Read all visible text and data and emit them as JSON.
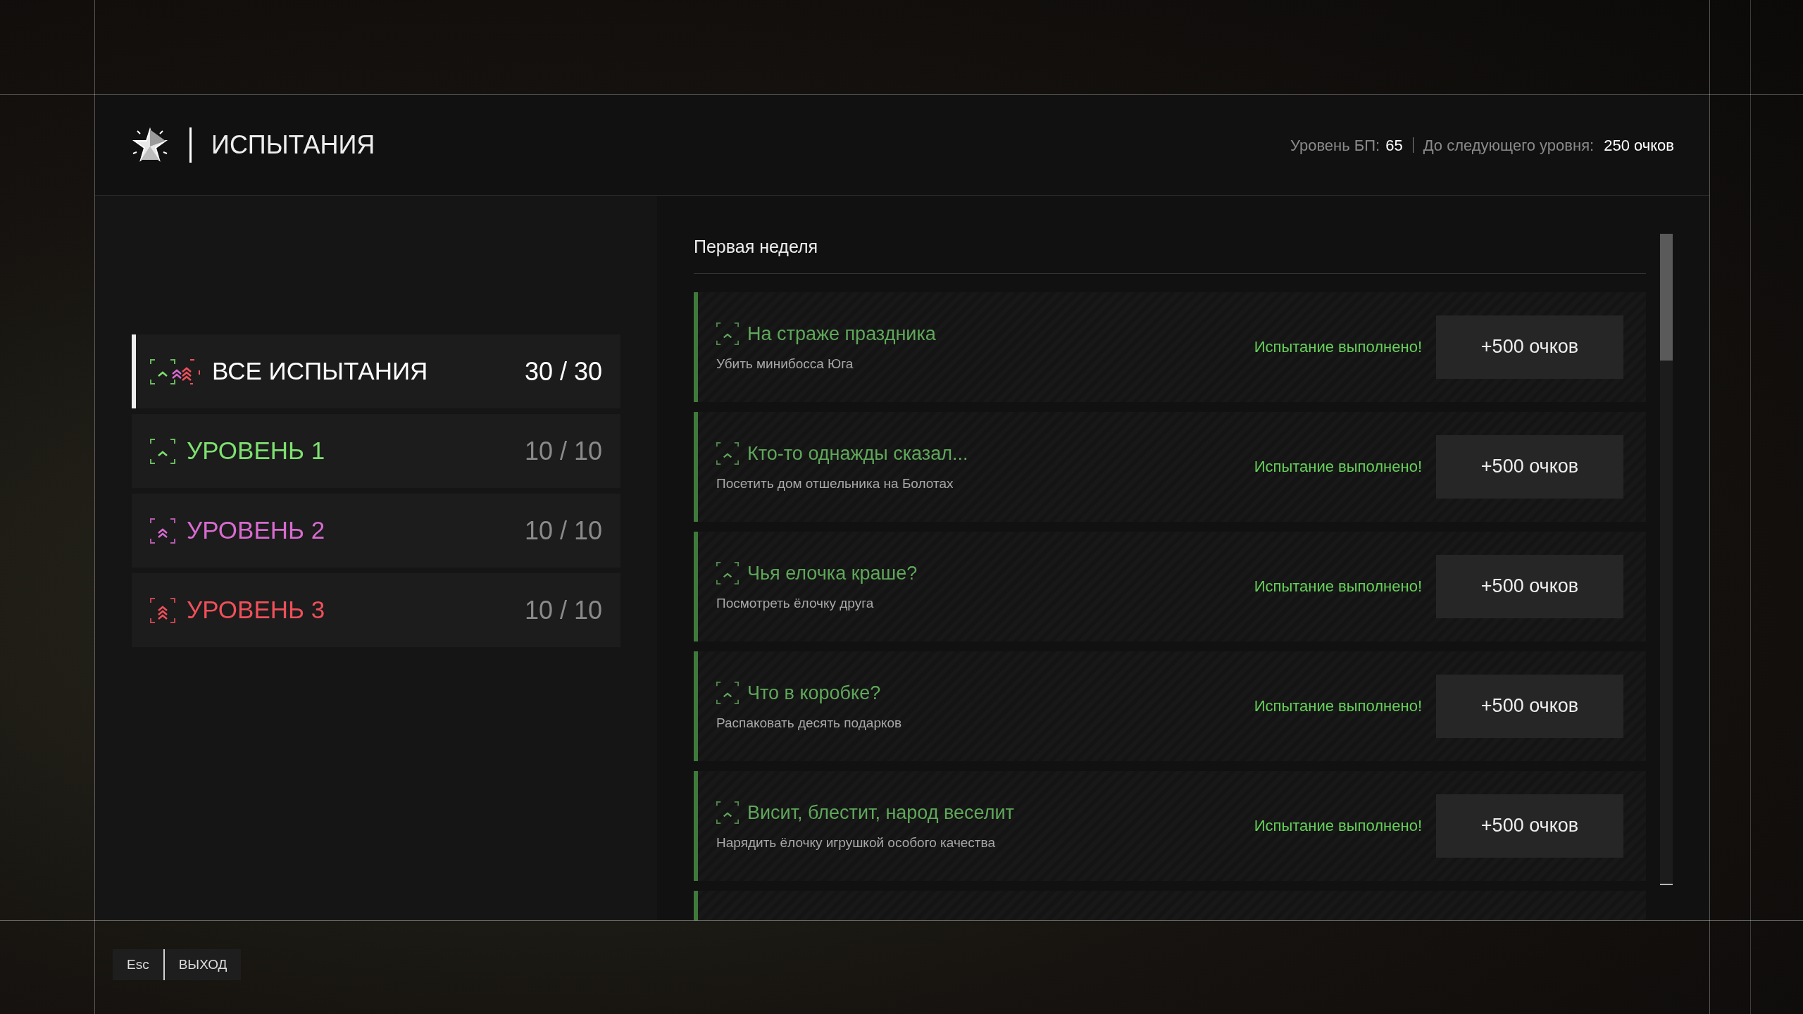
{
  "header": {
    "title": "ИСПЫТАНИЯ",
    "bp_label": "Уровень БП:",
    "bp_value": "65",
    "next_label": "До следующего уровня:",
    "next_value": "250 очков"
  },
  "categories": [
    {
      "kind": "all",
      "label": "ВСЕ ИСПЫТАНИЯ",
      "count": "30 / 30",
      "selected": true,
      "color": "#ffffff"
    },
    {
      "kind": "tier1",
      "label": "УРОВЕНЬ 1",
      "count": "10 / 10",
      "selected": false,
      "color": "#7ee070"
    },
    {
      "kind": "tier2",
      "label": "УРОВЕНЬ 2",
      "count": "10 / 10",
      "selected": false,
      "color": "#d86bd0"
    },
    {
      "kind": "tier3",
      "label": "УРОВЕНЬ 3",
      "count": "10 / 10",
      "selected": false,
      "color": "#f0505a"
    }
  ],
  "section_title": "Первая неделя",
  "tasks": [
    {
      "title": "На страже праздника",
      "description": "Убить минибосса Юга",
      "status": "Испытание выполнено!",
      "reward": "+500 очков",
      "completed": true
    },
    {
      "title": "Кто-то однажды сказал...",
      "description": "Посетить дом отшельника на Болотах",
      "status": "Испытание выполнено!",
      "reward": "+500 очков",
      "completed": true
    },
    {
      "title": "Чья елочка краше?",
      "description": "Посмотреть ёлочку друга",
      "status": "Испытание выполнено!",
      "reward": "+500 очков",
      "completed": true
    },
    {
      "title": "Что в коробке?",
      "description": "Распаковать десять подарков",
      "status": "Испытание выполнено!",
      "reward": "+500 очков",
      "completed": true
    },
    {
      "title": "Висит, блестит, народ веселит",
      "description": "Нарядить ёлочку игрушкой особого качества",
      "status": "Испытание выполнено!",
      "reward": "+500 очков",
      "completed": true
    }
  ],
  "footer": {
    "key": "Esc",
    "label": "ВЫХОД"
  }
}
